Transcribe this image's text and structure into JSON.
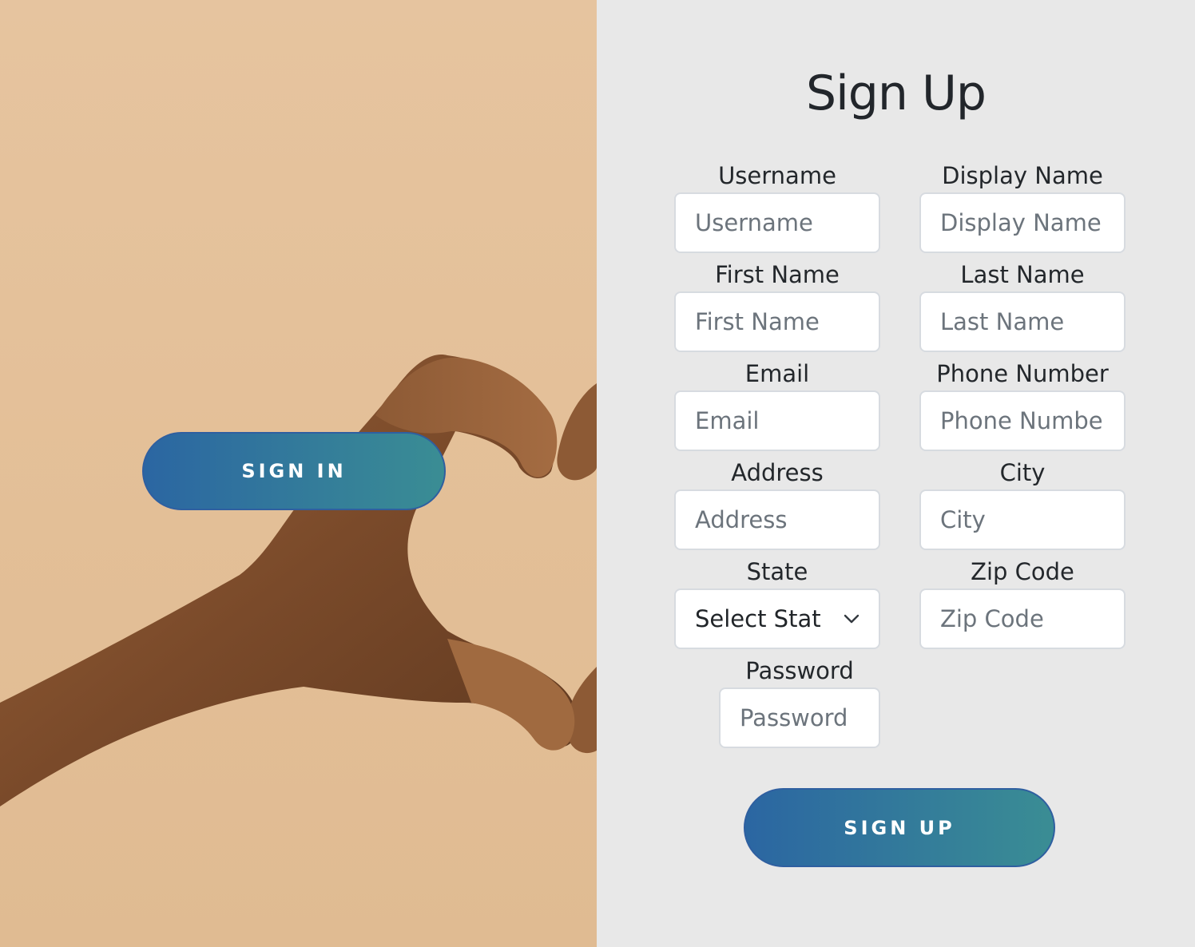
{
  "hero": {
    "image": "hand-heart-photo",
    "signin_label": "SIGN IN"
  },
  "form": {
    "title": "Sign Up",
    "fields": {
      "username": {
        "label": "Username",
        "placeholder": "Username"
      },
      "display_name": {
        "label": "Display Name",
        "placeholder": "Display Name"
      },
      "first_name": {
        "label": "First Name",
        "placeholder": "First Name"
      },
      "last_name": {
        "label": "Last Name",
        "placeholder": "Last Name"
      },
      "email": {
        "label": "Email",
        "placeholder": "Email"
      },
      "phone": {
        "label": "Phone Number",
        "placeholder": "Phone Numbe"
      },
      "address": {
        "label": "Address",
        "placeholder": "Address"
      },
      "city": {
        "label": "City",
        "placeholder": "City"
      },
      "state": {
        "label": "State",
        "selected": "Select Stat"
      },
      "zip": {
        "label": "Zip Code",
        "placeholder": "Zip Code"
      },
      "password": {
        "label": "Password",
        "placeholder": "Password"
      }
    },
    "submit_label": "SIGN UP"
  },
  "colors": {
    "accent_start": "#2b66a2",
    "accent_end": "#3a8d94",
    "panel_bg": "#e8e8e8",
    "hero_bg": "#e4c29b"
  }
}
